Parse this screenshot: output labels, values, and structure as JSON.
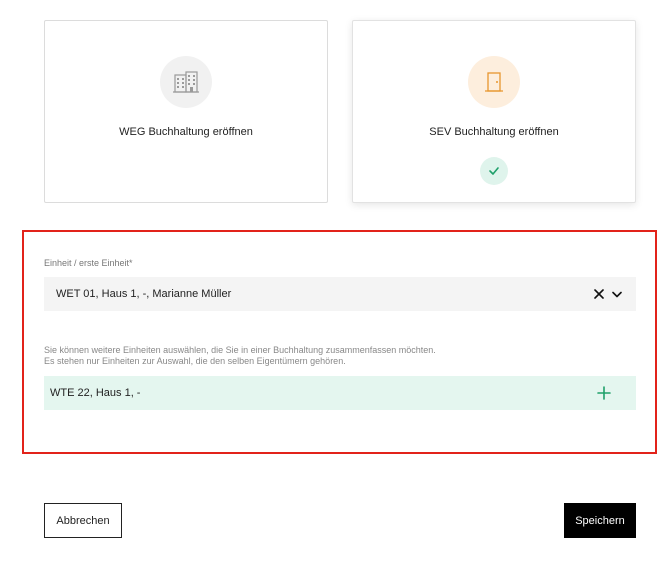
{
  "cards": [
    {
      "label": "WEG Buchhaltung eröffnen",
      "icon": "building-icon",
      "selected": false
    },
    {
      "label": "SEV Buchhaltung eröffnen",
      "icon": "door-icon",
      "selected": true
    }
  ],
  "unit_field": {
    "label": "Einheit / erste Einheit*",
    "value": "WET 01, Haus 1, -, Marianne Müller"
  },
  "help": {
    "line1": "Sie können weitere Einheiten auswählen, die Sie in einer Buchhaltung zusammenfassen möchten.",
    "line2": "Es stehen nur Einheiten zur Auswahl, die den selben Eigentümern gehören."
  },
  "additional_unit": {
    "value": "WTE 22, Haus 1, -"
  },
  "buttons": {
    "cancel": "Abbrechen",
    "save": "Speichern"
  },
  "colors": {
    "accent_orange": "#e8962e",
    "accent_green": "#1fa06a",
    "highlight_red": "#e2231a"
  }
}
